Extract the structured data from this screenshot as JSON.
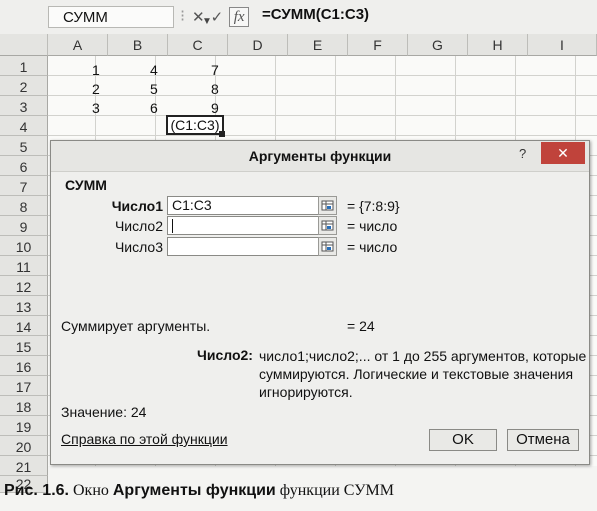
{
  "formula_bar": {
    "name_box": "СУММ",
    "cancel_glyph": "✕",
    "enter_glyph": "✓",
    "fx_label": "fx",
    "formula": "=СУММ(C1:C3)"
  },
  "columns": [
    "A",
    "B",
    "C",
    "D",
    "E",
    "F",
    "G",
    "H",
    "I"
  ],
  "rows": [
    "1",
    "2",
    "3",
    "4",
    "5",
    "6",
    "7",
    "8",
    "9",
    "10",
    "11",
    "12",
    "13",
    "14",
    "15",
    "16",
    "17",
    "18",
    "19",
    "20",
    "21",
    "22"
  ],
  "cells": {
    "A1": "1",
    "A2": "2",
    "A3": "3",
    "B1": "4",
    "B2": "5",
    "B3": "6",
    "C1": "7",
    "C2": "8",
    "C3": "9",
    "C4": "(C1:C3)"
  },
  "dialog": {
    "title": "Аргументы функции",
    "help_glyph": "?",
    "close_glyph": "✕",
    "function_name": "СУММ",
    "args": [
      {
        "label": "Число1",
        "value": "C1:C3",
        "result": "= {7:8:9}",
        "bold": true
      },
      {
        "label": "Число2",
        "value": "",
        "result": "= число",
        "bold": false
      },
      {
        "label": "Число3",
        "value": "",
        "result": "= число",
        "bold": false
      }
    ],
    "description": "Суммирует аргументы.",
    "description_result": "= 24",
    "arg_help_label": "Число2:",
    "arg_help_text": "число1;число2;... от 1 до 255 аргументов, которые суммируются. Логические и текстовые значения игнорируются.",
    "value_label": "Значение: 24",
    "help_link": "Справка по этой функции",
    "ok_label": "OK",
    "cancel_label": "Отмена"
  },
  "caption": {
    "prefix": "Рис. 1.6.",
    "text1": " Окно ",
    "bold": "Аргументы функции",
    "text2": " функции СУММ"
  }
}
